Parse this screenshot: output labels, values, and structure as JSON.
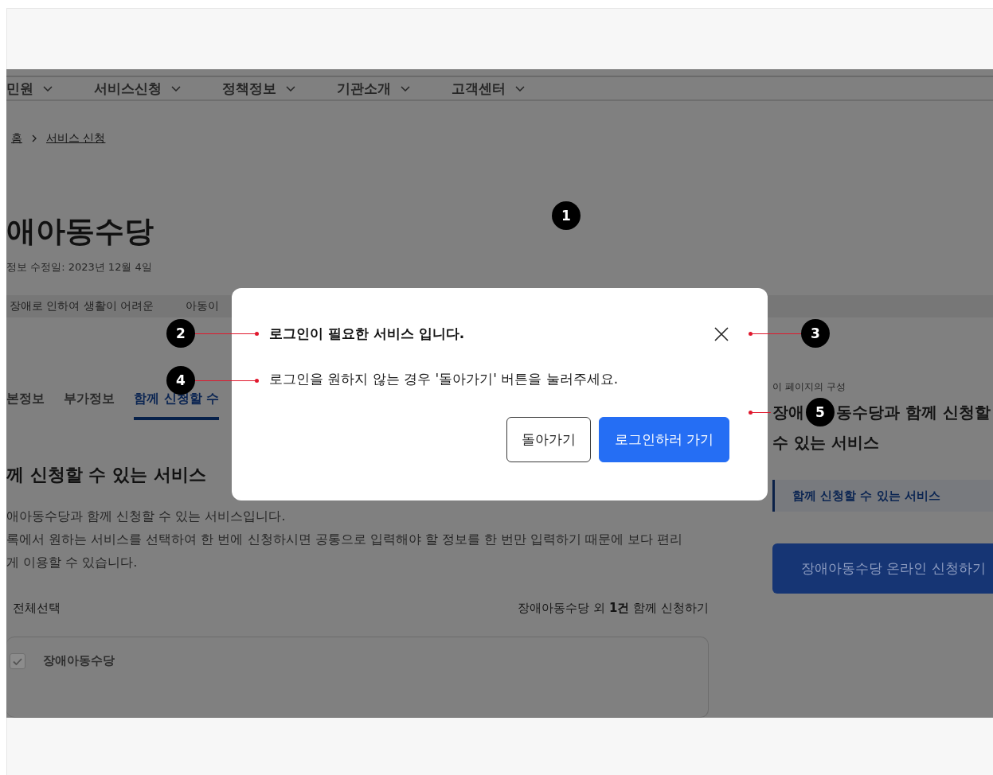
{
  "nav": {
    "items": [
      {
        "label": "민원"
      },
      {
        "label": "서비스신청"
      },
      {
        "label": "정책정보"
      },
      {
        "label": "기관소개"
      },
      {
        "label": "고객센터"
      }
    ]
  },
  "breadcrumb": [
    {
      "label": "홈"
    },
    {
      "label": "서비스 신청"
    }
  ],
  "page_title": "애아동수당",
  "updated": "정보 수정일: 2023년 12월 4일",
  "banner": [
    "장애로 인하여 생활이 어려운",
    "아동이"
  ],
  "tabs": [
    {
      "label": "본정보",
      "selected": false
    },
    {
      "label": "부가정보",
      "selected": false
    },
    {
      "label": "함께 신청할 수",
      "selected": true
    }
  ],
  "section": {
    "title": "께 신청할 수 있는 서비스",
    "lines": [
      "애아동수당과 함께 신청할 수 있는 서비스입니다.",
      "록에서 원하는 서비스를 선택하여 한 번에 신청하시면 공통으로 입력해야 할 정보를 한 번만 입력하기 때문에 보다 편리",
      "게 이용할 수 있습니다."
    ]
  },
  "select_all": "전체선택",
  "apply_summary": "장애아동수당 외 **1건** 함께 신청하기",
  "service_card": {
    "name": "장애아동수당",
    "checked": true
  },
  "toc": {
    "caption": "이 페이지의 구성",
    "title_start": "장애",
    "title_rest": "동수당과 함께 신청할",
    "title_line2": "수 있는 서비스",
    "links": [
      {
        "label": "함께 신청할 수 있는 서비스",
        "selected": true
      }
    ]
  },
  "apply_button": "장애아동수당 온라인 신청하기",
  "dialog": {
    "title": "로그인이 필요한 서비스 입니다.",
    "message": "로그인을 원하지 않는 경우 '돌아가기' 버튼을 눌러주세요.",
    "buttons": [
      {
        "label": "돌아가기",
        "kind": "secondary"
      },
      {
        "label": "로그인하러 가기",
        "kind": "primary"
      }
    ]
  },
  "annotations": [
    {
      "number": "1"
    },
    {
      "number": "2"
    },
    {
      "number": "3"
    },
    {
      "number": "4"
    },
    {
      "number": "5"
    }
  ]
}
